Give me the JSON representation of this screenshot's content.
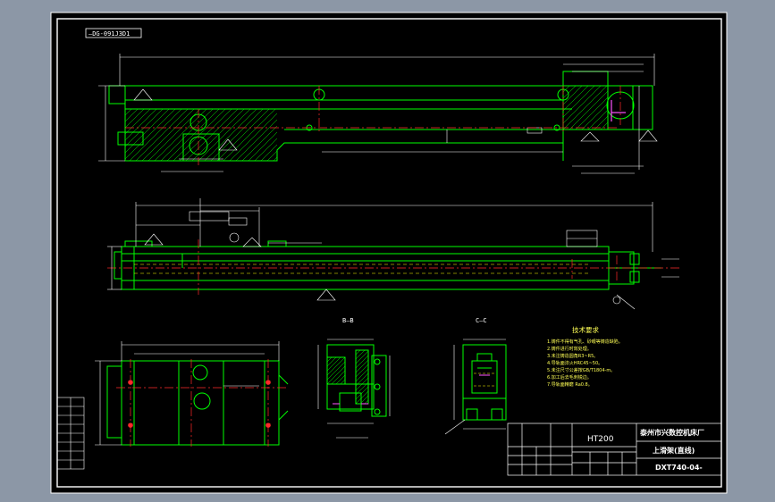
{
  "colors": {
    "background": "#8c97a6",
    "sheet": "#000000",
    "frame": "#ffffff",
    "geometry": "#00ff00",
    "dimension": "#ffffff",
    "centerline": "#ff2a2a",
    "hidden": "#ffff00",
    "hatch": "#00ff00",
    "accent": "#ff55ff",
    "note_text": "#ffff55"
  },
  "drawing": {
    "number_tag": "—DG-091J3D1",
    "tech_notes": {
      "title": "技术要求",
      "items": [
        "1.铸件不得有气孔、砂眼等铸造缺陷。",
        "2.铸件进行时效处理。",
        "3.未注铸造圆角R3~R5。",
        "4.导轨面淬火HRC45~50。",
        "5.未注尺寸公差按GB/T1804-m。",
        "6.加工后去毛刺锐边。",
        "7.导轨面精磨 Ra0.8。"
      ]
    },
    "section_labels": [
      "B—B",
      "C—C"
    ],
    "title_block": {
      "material": "HT200",
      "company": "泰州市兴数控机床厂",
      "part_name": "上滑架(直线)",
      "drawing_no": "DXT740-04-"
    }
  }
}
